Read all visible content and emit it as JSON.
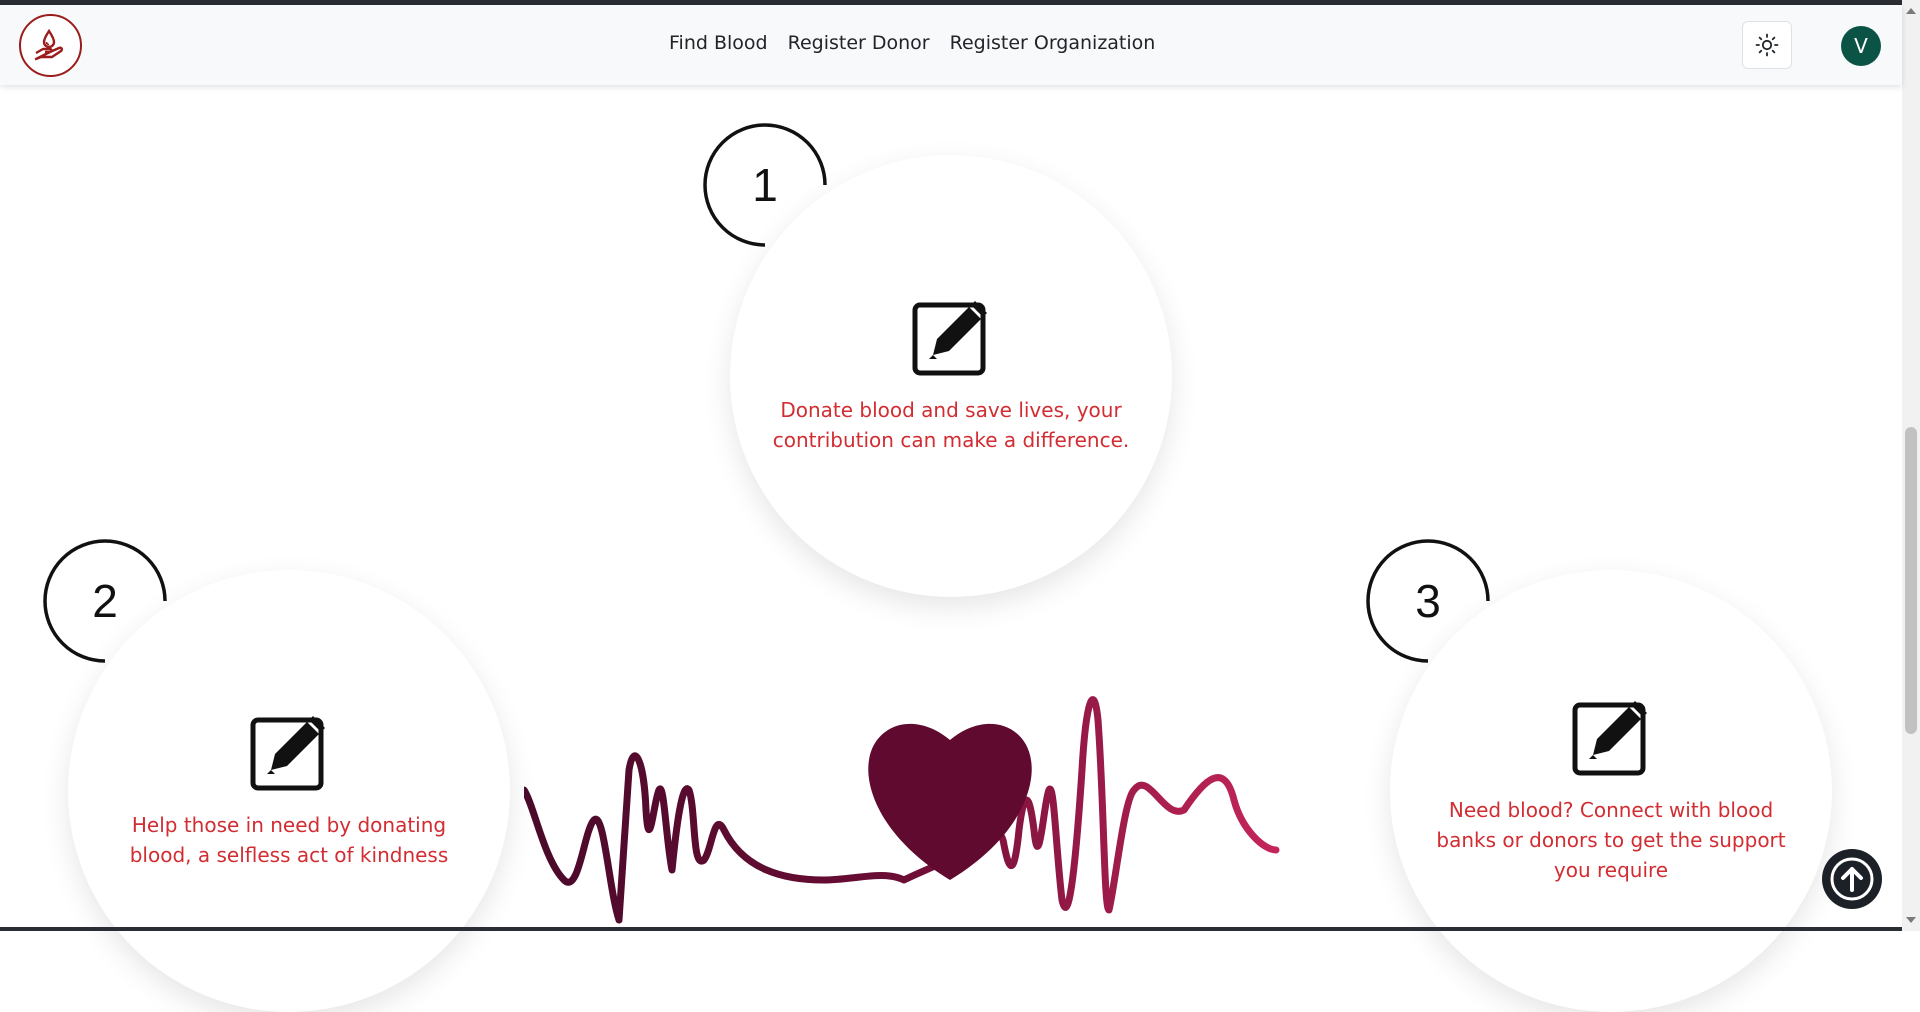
{
  "nav": {
    "links": [
      "Find Blood",
      "Register Donor",
      "Register Organization"
    ],
    "theme_icon": "sun-icon",
    "logo_icon": "blood-donation-hand-icon",
    "avatar_initial": "V"
  },
  "steps": [
    {
      "number": "1",
      "icon": "edit-icon",
      "text": "Donate blood and save lives, your contribution can make a difference."
    },
    {
      "number": "2",
      "icon": "edit-icon",
      "text": "Help those in need by donating blood, a selfless act of kindness"
    },
    {
      "number": "3",
      "icon": "edit-icon",
      "text": "Need blood? Connect with blood banks or donors to get the support you require"
    }
  ],
  "illustration": {
    "icon": "heartbeat-heart-icon"
  },
  "back_to_top": {
    "icon": "arrow-up-circle-icon"
  },
  "colors": {
    "brand": "#9b1c1c",
    "text_accent": "#d12d32",
    "avatar": "#0b5345",
    "heart": "#5f0a2e"
  }
}
